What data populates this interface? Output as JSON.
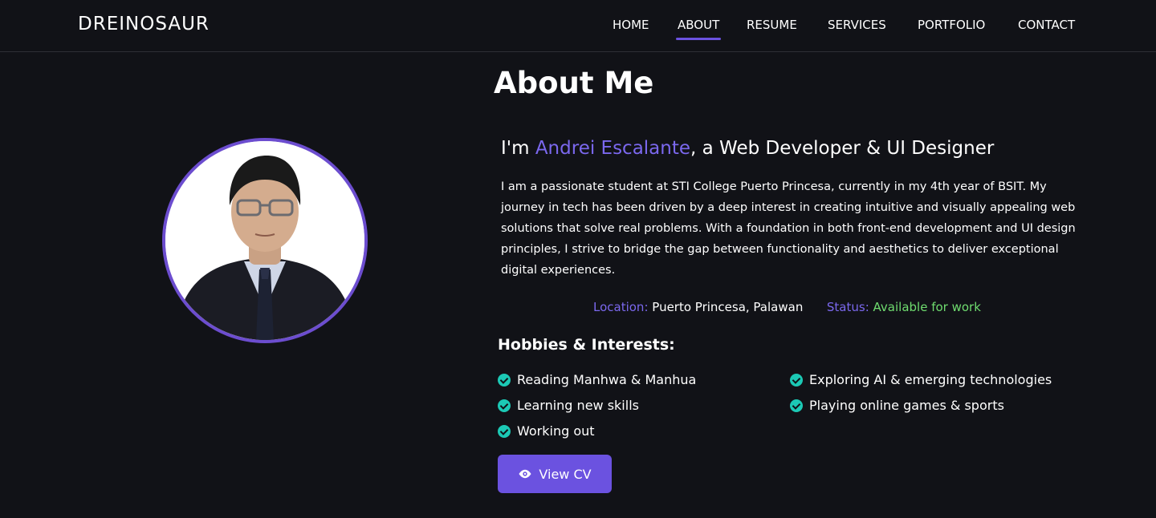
{
  "brand": "DREINOSAUR",
  "nav": {
    "home": "HOME",
    "about": "ABOUT",
    "resume": "RESUME",
    "services": "SERVICES",
    "portfolio": "PORTFOLIO",
    "contact": "CONTACT",
    "active": "ABOUT"
  },
  "page_title": "About Me",
  "intro": {
    "prefix": "I'm ",
    "name": "Andrei Escalante",
    "suffix": ", a Web Developer & UI Designer"
  },
  "bio": "I am a passionate student at STI College Puerto Princesa, currently in my 4th year of BSIT. My journey in tech has been driven by a deep interest in creating intuitive and visually appealing web solutions that solve real problems. With a  foundation in both front-end development and UI design principles, I strive to bridge the gap between functionality and aesthetics to deliver exceptional digital experiences.",
  "info": {
    "location_label": "Location:",
    "location_value": "Puerto Princesa, Palawan",
    "status_label": "Status:",
    "status_value": "Available for work"
  },
  "hobbies": {
    "title": "Hobbies & Interests:",
    "items": [
      "Reading Manhwa & Manhua",
      "Exploring AI & emerging technologies",
      "Learning new skills",
      "Playing online games & sports",
      "Working out"
    ]
  },
  "cv_button": {
    "label": "View CV",
    "icon": "eye-icon"
  },
  "colors": {
    "background": "#111217",
    "accent": "#7b68ee",
    "button": "#6b52e0",
    "check": "#1cc9b5",
    "status": "#6fdc6f"
  }
}
